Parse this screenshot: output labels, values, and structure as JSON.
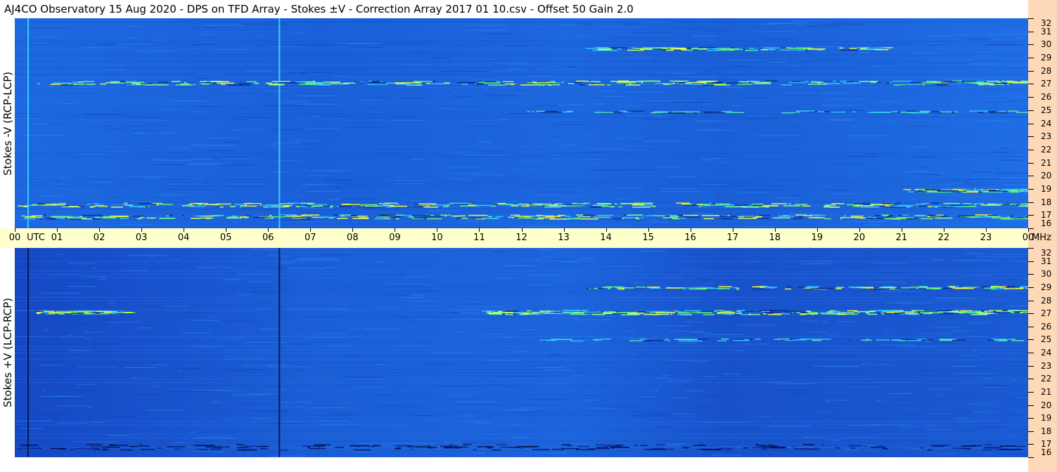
{
  "title": "AJ4CO Observatory  15 Aug 2020  -  DPS on TFD Array  -  Stokes ±V  -  Correction Array 2017 01 10.csv  -  Offset 50  Gain 2.0",
  "colors": {
    "background_blue": "#1f6fe6",
    "deep_blue": "#0a3fb0",
    "cyan": "#33ccff",
    "green": "#66ff66",
    "yellow": "#ffff33",
    "axis_yellow": "#ffffcc",
    "strip_peach": "#fdd9b7"
  },
  "chart_data": [
    {
      "type": "heatmap",
      "panel": "top",
      "ylabel": "Stokes -V (RCP-LCP)",
      "x_unit": "UTC",
      "x_range": [
        "00",
        "00"
      ],
      "y_unit": "MHz",
      "ylim": [
        16,
        32
      ],
      "yticks": [
        16,
        17,
        18,
        19,
        20,
        21,
        22,
        23,
        24,
        25,
        26,
        27,
        28,
        29,
        30,
        31,
        32
      ],
      "colormap": [
        "#0a2a90",
        "#1f6fe6",
        "#33ccff",
        "#66ff66",
        "#ffff33",
        "#ff6600"
      ],
      "features": [
        {
          "type": "vertical_line",
          "utc_hour": 0.3,
          "color": "#33ccff"
        },
        {
          "type": "vertical_line",
          "utc_hour": 6.25,
          "color": "#33ccff"
        },
        {
          "type": "emission_band",
          "freq_mhz": 27.1,
          "utc_start": 0.5,
          "utc_end": 24.0,
          "intensity": "strong"
        },
        {
          "type": "emission_band",
          "freq_mhz": 17.8,
          "utc_start": 0.0,
          "utc_end": 24.0,
          "intensity": "strong"
        },
        {
          "type": "emission_band",
          "freq_mhz": 16.9,
          "utc_start": 0.0,
          "utc_end": 24.0,
          "intensity": "strong"
        },
        {
          "type": "emission_band",
          "freq_mhz": 29.7,
          "utc_start": 13.5,
          "utc_end": 20.5,
          "intensity": "moderate"
        },
        {
          "type": "emission_band",
          "freq_mhz": 24.9,
          "utc_start": 12.0,
          "utc_end": 24.0,
          "intensity": "weak"
        },
        {
          "type": "emission_band",
          "freq_mhz": 18.9,
          "utc_start": 21.0,
          "utc_end": 24.0,
          "intensity": "moderate"
        }
      ]
    },
    {
      "type": "heatmap",
      "panel": "bottom",
      "ylabel": "Stokes +V (LCP-RCP)",
      "x_unit": "UTC",
      "x_range": [
        "00",
        "00"
      ],
      "y_unit": "MHz",
      "ylim": [
        16,
        32
      ],
      "yticks": [
        16,
        17,
        18,
        19,
        20,
        21,
        22,
        23,
        24,
        25,
        26,
        27,
        28,
        29,
        30,
        31,
        32
      ],
      "colormap": [
        "#0a2a90",
        "#1f6fe6",
        "#33ccff",
        "#66ff66",
        "#ffff33",
        "#ff6600"
      ],
      "features": [
        {
          "type": "vertical_line",
          "utc_hour": 0.3,
          "color": "#0a1a50"
        },
        {
          "type": "vertical_line",
          "utc_hour": 6.25,
          "color": "#0a1a50"
        },
        {
          "type": "emission_band",
          "freq_mhz": 27.1,
          "utc_start": 11.0,
          "utc_end": 24.0,
          "intensity": "strong"
        },
        {
          "type": "emission_band",
          "freq_mhz": 27.1,
          "utc_start": 0.5,
          "utc_end": 2.5,
          "intensity": "moderate"
        },
        {
          "type": "emission_band",
          "freq_mhz": 29.0,
          "utc_start": 13.5,
          "utc_end": 24.0,
          "intensity": "moderate"
        },
        {
          "type": "emission_band",
          "freq_mhz": 25.0,
          "utc_start": 12.0,
          "utc_end": 24.0,
          "intensity": "weak"
        },
        {
          "type": "absorption_band",
          "freq_mhz": 16.8,
          "utc_start": 0.0,
          "utc_end": 24.0,
          "intensity": "dark"
        }
      ]
    }
  ],
  "time_axis": {
    "labels": [
      "00",
      "01",
      "02",
      "03",
      "04",
      "05",
      "06",
      "07",
      "08",
      "09",
      "10",
      "11",
      "12",
      "13",
      "14",
      "15",
      "16",
      "17",
      "18",
      "19",
      "20",
      "21",
      "22",
      "23",
      "00"
    ],
    "utc_label": "UTC",
    "mhz_label": "MHz"
  }
}
